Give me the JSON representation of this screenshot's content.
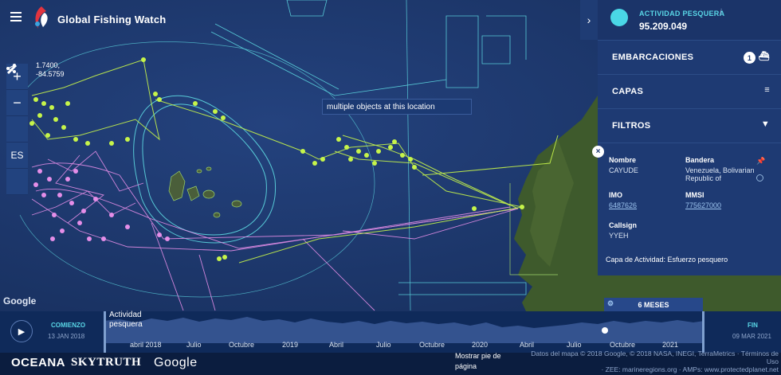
{
  "app": {
    "title": "Global Fishing Watch"
  },
  "map": {
    "coords_lat": "1.7400,",
    "coords_lon": "-84.5759",
    "tools": {
      "zoom_in": "+",
      "zoom_out": "−",
      "language": "ES"
    },
    "tooltip": "multiple objects at this location",
    "google_watermark": "Google"
  },
  "panel": {
    "activity": {
      "label": "ACTIVIDAD PESQUERA",
      "info": "i",
      "value": "95.209.049"
    },
    "sections": [
      {
        "label": "EMBARCACIONES",
        "badge": "1",
        "icon": "vessel-icon"
      },
      {
        "label": "CAPAS",
        "icon": "layers-icon"
      },
      {
        "label": "FILTROS",
        "icon": "filter-icon"
      }
    ],
    "vessel": {
      "name_label": "Nombre",
      "name": "CAYUDE",
      "flag_label": "Bandera",
      "flag": "Venezuela, Bolivarian Republic of",
      "imo_label": "IMO",
      "imo": "6487626",
      "mmsi_label": "MMSI",
      "mmsi": "775627000",
      "callsign_label": "Callsign",
      "callsign": "YYEH",
      "layer_text": "Capa de Actividad: Esfuerzo pesquero"
    }
  },
  "timebar": {
    "start_label": "COMIENZO",
    "start_date": "13 JAN 2018",
    "end_label": "FIN",
    "end_date": "09 MAR 2021",
    "track_label_1": "Actividad",
    "track_label_2": "pesquera",
    "mode_button": "6 MESES",
    "ticks": [
      "abril 2018",
      "Julio",
      "Octubre",
      "2019",
      "Abril",
      "Julio",
      "Octubre",
      "2020",
      "Abril",
      "Julio",
      "Octubre",
      "2021"
    ]
  },
  "footer": {
    "logos": [
      "OCEANA",
      "SKYTRUTH",
      "Google"
    ],
    "caption_button_1": "Mostrar pie de",
    "caption_button_2": "página",
    "attribution_1": "Datos del mapa © 2018 Google, © 2018 NASA, INEGI, TerraMetrics · Términos de",
    "attribution_2": "Uso",
    "attribution_3": "· ZEE: marineregions.org · AMPs: www.protectedplanet.net"
  },
  "colors": {
    "track_green": "#c6f44a",
    "track_pink": "#e58ee8",
    "eez_cyan": "#57c9d6",
    "panel": "#1e3a73"
  }
}
